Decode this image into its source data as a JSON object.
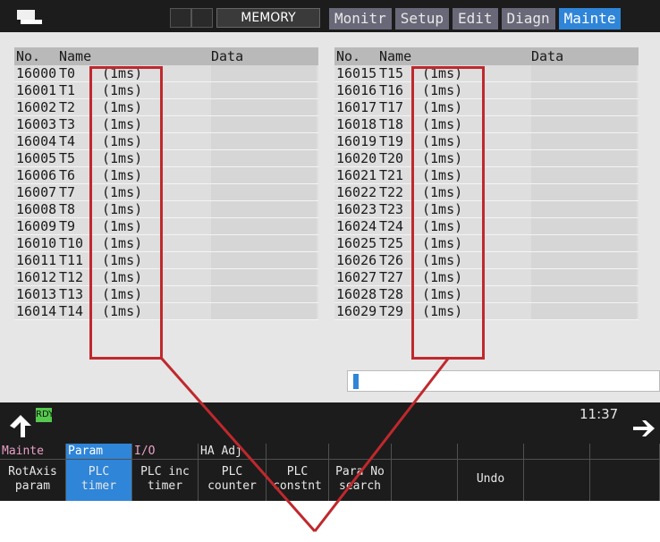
{
  "header": {
    "mode": "MEMORY",
    "tabs": [
      {
        "label": "Monitr",
        "active": false
      },
      {
        "label": "Setup",
        "active": false
      },
      {
        "label": "Edit",
        "active": false
      },
      {
        "label": "Diagn",
        "active": false
      },
      {
        "label": "Mainte",
        "active": true
      }
    ]
  },
  "table": {
    "col_no": "No.",
    "col_name": "Name",
    "col_data": "Data",
    "left_rows": [
      {
        "no": "16000",
        "name": "T0",
        "unit": "(1ms)",
        "data": ""
      },
      {
        "no": "16001",
        "name": "T1",
        "unit": "(1ms)",
        "data": ""
      },
      {
        "no": "16002",
        "name": "T2",
        "unit": "(1ms)",
        "data": ""
      },
      {
        "no": "16003",
        "name": "T3",
        "unit": "(1ms)",
        "data": ""
      },
      {
        "no": "16004",
        "name": "T4",
        "unit": "(1ms)",
        "data": ""
      },
      {
        "no": "16005",
        "name": "T5",
        "unit": "(1ms)",
        "data": ""
      },
      {
        "no": "16006",
        "name": "T6",
        "unit": "(1ms)",
        "data": ""
      },
      {
        "no": "16007",
        "name": "T7",
        "unit": "(1ms)",
        "data": ""
      },
      {
        "no": "16008",
        "name": "T8",
        "unit": "(1ms)",
        "data": ""
      },
      {
        "no": "16009",
        "name": "T9",
        "unit": "(1ms)",
        "data": ""
      },
      {
        "no": "16010",
        "name": "T10",
        "unit": "(1ms)",
        "data": ""
      },
      {
        "no": "16011",
        "name": "T11",
        "unit": "(1ms)",
        "data": ""
      },
      {
        "no": "16012",
        "name": "T12",
        "unit": "(1ms)",
        "data": ""
      },
      {
        "no": "16013",
        "name": "T13",
        "unit": "(1ms)",
        "data": ""
      },
      {
        "no": "16014",
        "name": "T14",
        "unit": "(1ms)",
        "data": ""
      }
    ],
    "right_rows": [
      {
        "no": "16015",
        "name": "T15",
        "unit": "(1ms)",
        "data": ""
      },
      {
        "no": "16016",
        "name": "T16",
        "unit": "(1ms)",
        "data": ""
      },
      {
        "no": "16017",
        "name": "T17",
        "unit": "(1ms)",
        "data": ""
      },
      {
        "no": "16018",
        "name": "T18",
        "unit": "(1ms)",
        "data": ""
      },
      {
        "no": "16019",
        "name": "T19",
        "unit": "(1ms)",
        "data": ""
      },
      {
        "no": "16020",
        "name": "T20",
        "unit": "(1ms)",
        "data": ""
      },
      {
        "no": "16021",
        "name": "T21",
        "unit": "(1ms)",
        "data": ""
      },
      {
        "no": "16022",
        "name": "T22",
        "unit": "(1ms)",
        "data": ""
      },
      {
        "no": "16023",
        "name": "T23",
        "unit": "(1ms)",
        "data": ""
      },
      {
        "no": "16024",
        "name": "T24",
        "unit": "(1ms)",
        "data": ""
      },
      {
        "no": "16025",
        "name": "T25",
        "unit": "(1ms)",
        "data": ""
      },
      {
        "no": "16026",
        "name": "T26",
        "unit": "(1ms)",
        "data": ""
      },
      {
        "no": "16027",
        "name": "T27",
        "unit": "(1ms)",
        "data": ""
      },
      {
        "no": "16028",
        "name": "T28",
        "unit": "(1ms)",
        "data": ""
      },
      {
        "no": "16029",
        "name": "T29",
        "unit": "(1ms)",
        "data": ""
      }
    ]
  },
  "status": {
    "rdy": "RDY",
    "clock": "11:37"
  },
  "softkeys": [
    {
      "group": "Mainte",
      "line1": "RotAxis",
      "line2": "param",
      "selected": false
    },
    {
      "group": "Param",
      "line1": "PLC",
      "line2": "timer",
      "selected": true
    },
    {
      "group": "I/O",
      "line1": "PLC inc",
      "line2": "timer",
      "selected": false
    },
    {
      "group": "HA Adj.",
      "line1": "PLC",
      "line2": "counter",
      "selected": false
    },
    {
      "group": "",
      "line1": "PLC",
      "line2": "constnt",
      "selected": false
    },
    {
      "group": "",
      "line1": "Para No",
      "line2": "search",
      "selected": false
    },
    {
      "group": "",
      "line1": "",
      "line2": "",
      "selected": false
    },
    {
      "group": "",
      "line1": "Undo",
      "line2": "",
      "selected": false
    },
    {
      "group": "",
      "line1": "",
      "line2": "",
      "selected": false
    },
    {
      "group": "",
      "line1": "",
      "line2": "",
      "selected": false
    }
  ],
  "colors": {
    "accent": "#2f85d8",
    "ready": "#55c84e",
    "highlight": "#c0282d",
    "group_text": "#e8a0c4"
  },
  "icons": {
    "logo": "screen-logo-icon",
    "menu_up": "arrow-up-icon",
    "next_menu": "arrow-right-icon"
  }
}
